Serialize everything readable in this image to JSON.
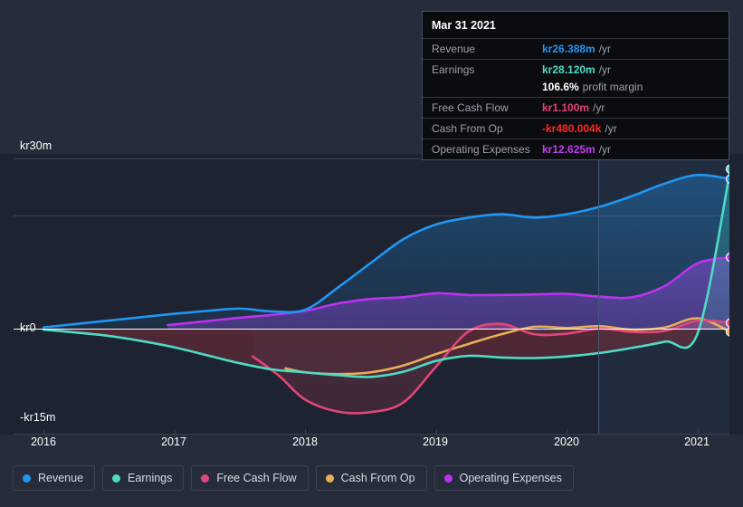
{
  "theme": {
    "background": "#262c39",
    "plot_background": "#1d2330",
    "grid_color": "#3a4150",
    "zero_line_color": "#ffffff",
    "axis_text_color": "#ffffff",
    "cursor_line_color": "#3f5068"
  },
  "tooltip": {
    "date": "Mar 31 2021",
    "rows": [
      {
        "key": "Revenue",
        "value": "kr26.388m",
        "suffix": "/yr",
        "color": "#2196f3"
      },
      {
        "key": "Earnings",
        "value": "kr28.120m",
        "suffix": "/yr",
        "color": "#4ddbc4"
      },
      {
        "key": "",
        "value": "106.6%",
        "suffix": "profit margin",
        "color": "#ffffff"
      },
      {
        "key": "Free Cash Flow",
        "value": "kr1.100m",
        "suffix": "/yr",
        "color": "#e83e73"
      },
      {
        "key": "Cash From Op",
        "value": "-kr480.004k",
        "suffix": "/yr",
        "color": "#ff2a1f"
      },
      {
        "key": "Operating Expenses",
        "value": "kr12.625m",
        "suffix": "/yr",
        "color": "#c13ff0"
      }
    ]
  },
  "legend": {
    "items": [
      {
        "label": "Revenue",
        "color": "#2196f3"
      },
      {
        "label": "Earnings",
        "color": "#4ddbc4"
      },
      {
        "label": "Free Cash Flow",
        "color": "#e0467a"
      },
      {
        "label": "Cash From Op",
        "color": "#e8ae58"
      },
      {
        "label": "Operating Expenses",
        "color": "#bb33ee"
      }
    ]
  },
  "chart_data": {
    "type": "area",
    "title": "",
    "xlabel": "",
    "ylabel": "",
    "currency_prefix": "kr",
    "y_ticks": [
      {
        "label": "kr30m",
        "value": 30
      },
      {
        "label": "kr0",
        "value": 0
      },
      {
        "label": "-kr15m",
        "value": -15
      }
    ],
    "ylim": [
      -16.5,
      32.0
    ],
    "x_ticks": [
      "2016",
      "2017",
      "2018",
      "2019",
      "2020",
      "2021"
    ],
    "xlim": [
      "2015-10",
      "2021-04"
    ],
    "grid": true,
    "legend_position": "bottom",
    "cursor_date": "Mar 31 2021",
    "series": [
      {
        "name": "Revenue",
        "color": "#2196f3",
        "x": [
          "2016",
          "2016.25",
          "2016.5",
          "2016.75",
          "2017",
          "2017.25",
          "2017.5",
          "2017.75",
          "2018",
          "2018.25",
          "2018.5",
          "2018.75",
          "2019",
          "2019.25",
          "2019.5",
          "2019.75",
          "2020",
          "2020.25",
          "2020.5",
          "2020.75",
          "2021",
          "2021.25"
        ],
        "values": [
          0.3,
          0.9,
          1.5,
          2.1,
          2.7,
          3.2,
          3.6,
          3.1,
          3.4,
          7.3,
          11.6,
          15.8,
          18.4,
          19.6,
          20.2,
          19.6,
          20.2,
          21.5,
          23.4,
          25.6,
          27.1,
          26.388
        ]
      },
      {
        "name": "Earnings",
        "color": "#4ddbc4",
        "x": [
          "2016",
          "2016.25",
          "2016.5",
          "2016.75",
          "2017",
          "2017.25",
          "2017.5",
          "2017.75",
          "2018",
          "2018.25",
          "2018.5",
          "2018.75",
          "2019",
          "2019.25",
          "2019.5",
          "2019.75",
          "2020",
          "2020.25",
          "2020.5",
          "2020.75",
          "2021",
          "2021.25"
        ],
        "values": [
          -0.1,
          -0.6,
          -1.2,
          -2.1,
          -3.2,
          -4.6,
          -6.0,
          -7.1,
          -7.6,
          -8.1,
          -8.4,
          -7.5,
          -5.6,
          -4.7,
          -5.0,
          -5.1,
          -4.8,
          -4.2,
          -3.3,
          -2.2,
          -0.7,
          28.12
        ]
      },
      {
        "name": "Free Cash Flow",
        "color": "#e0467a",
        "x": [
          "2017.6",
          "2017.8",
          "2018",
          "2018.25",
          "2018.5",
          "2018.75",
          "2019",
          "2019.25",
          "2019.5",
          "2019.75",
          "2020",
          "2020.25",
          "2020.5",
          "2020.75",
          "2021",
          "2021.25"
        ],
        "values": [
          -4.8,
          -8.2,
          -12.4,
          -14.5,
          -14.6,
          -12.9,
          -6.6,
          -0.4,
          0.9,
          -0.9,
          -0.8,
          0.1,
          -0.5,
          -0.3,
          1.5,
          1.1
        ]
      },
      {
        "name": "Cash From Op",
        "color": "#e8ae58",
        "x": [
          "2017.85",
          "2018",
          "2018.25",
          "2018.5",
          "2018.75",
          "2019",
          "2019.25",
          "2019.5",
          "2019.75",
          "2020",
          "2020.25",
          "2020.5",
          "2020.75",
          "2021",
          "2021.25"
        ],
        "values": [
          -6.9,
          -7.6,
          -7.9,
          -7.6,
          -6.4,
          -4.4,
          -2.6,
          -0.9,
          0.4,
          0.2,
          0.5,
          -0.1,
          0.3,
          1.9,
          -0.48
        ]
      },
      {
        "name": "Operating Expenses",
        "color": "#bb33ee",
        "x": [
          "2016.95",
          "2017.25",
          "2017.5",
          "2017.75",
          "2018",
          "2018.25",
          "2018.5",
          "2018.75",
          "2019",
          "2019.25",
          "2019.5",
          "2019.75",
          "2020",
          "2020.25",
          "2020.5",
          "2020.75",
          "2021",
          "2021.25"
        ],
        "values": [
          0.7,
          1.4,
          2.0,
          2.5,
          3.2,
          4.5,
          5.3,
          5.6,
          6.3,
          6.0,
          6.0,
          6.1,
          6.2,
          5.7,
          5.6,
          7.6,
          11.6,
          12.625
        ]
      }
    ]
  }
}
